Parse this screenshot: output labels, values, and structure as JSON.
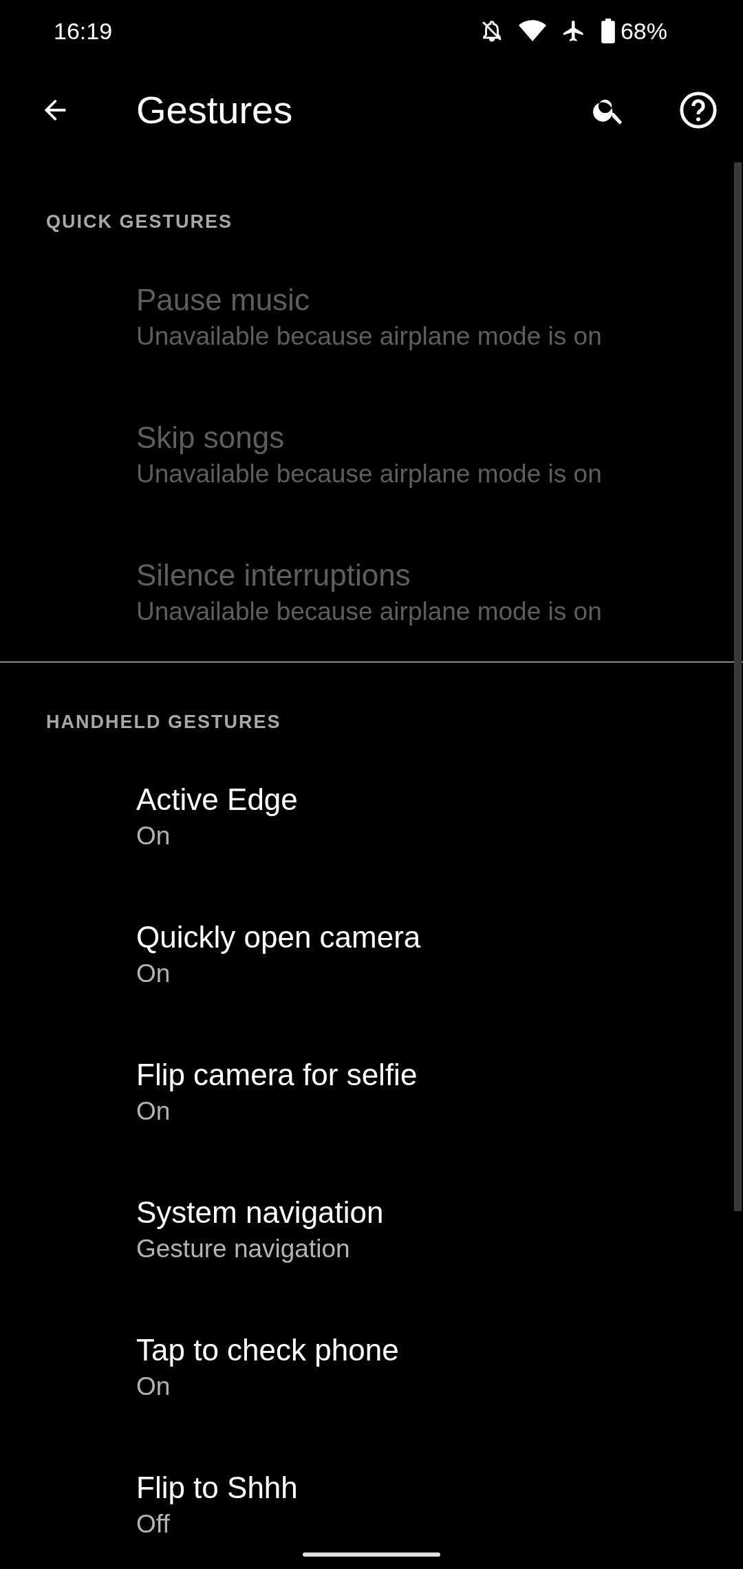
{
  "status_bar": {
    "time": "16:19",
    "battery": "68%"
  },
  "toolbar": {
    "title": "Gestures"
  },
  "sections": [
    {
      "header": "QUICK GESTURES",
      "items": [
        {
          "title": "Pause music",
          "summary": "Unavailable because airplane mode is on",
          "disabled": true
        },
        {
          "title": "Skip songs",
          "summary": "Unavailable because airplane mode is on",
          "disabled": true
        },
        {
          "title": "Silence interruptions",
          "summary": "Unavailable because airplane mode is on",
          "disabled": true
        }
      ]
    },
    {
      "header": "HANDHELD GESTURES",
      "items": [
        {
          "title": "Active Edge",
          "summary": "On",
          "disabled": false
        },
        {
          "title": "Quickly open camera",
          "summary": "On",
          "disabled": false
        },
        {
          "title": "Flip camera for selfie",
          "summary": "On",
          "disabled": false
        },
        {
          "title": "System navigation",
          "summary": "Gesture navigation",
          "disabled": false
        },
        {
          "title": "Tap to check phone",
          "summary": "On",
          "disabled": false
        },
        {
          "title": "Flip to Shhh",
          "summary": "Off",
          "disabled": false
        }
      ]
    }
  ]
}
